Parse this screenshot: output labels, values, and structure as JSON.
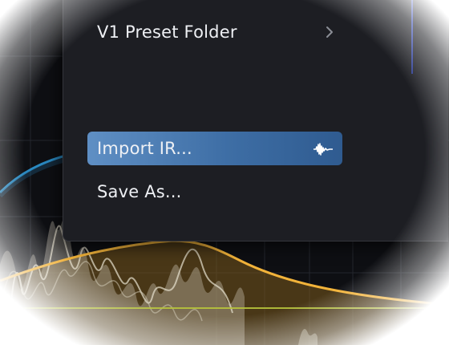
{
  "menu": {
    "items": [
      {
        "label": "V1 Preset Folder",
        "has_submenu": true,
        "icon": "chevron-right-icon"
      },
      {
        "label": "Import IR...",
        "highlighted": true,
        "icon": "waveform-icon"
      },
      {
        "label": "Save As..."
      }
    ]
  },
  "colors": {
    "background": "#0e0f13",
    "menu_background": "#1d1e23",
    "highlight": "#3e6ea5",
    "curve_orange": "#f2b33a",
    "curve_blue": "#2f9fe0",
    "baseline_green": "#b7c43c"
  }
}
